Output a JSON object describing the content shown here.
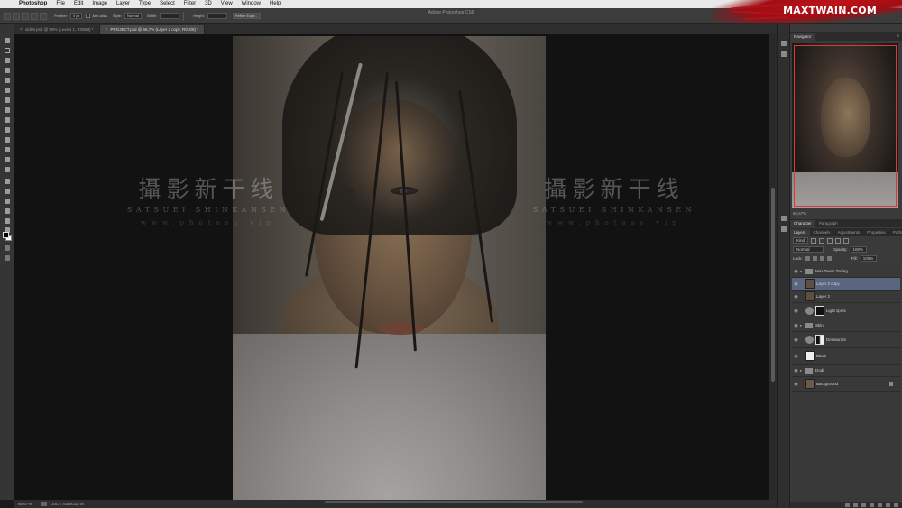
{
  "menubar": {
    "app_name": "Photoshop",
    "items": [
      "File",
      "Edit",
      "Image",
      "Layer",
      "Type",
      "Select",
      "Filter",
      "3D",
      "View",
      "Window",
      "Help"
    ]
  },
  "brand": {
    "name": "MAXTWAIN.COM",
    "color": "#b3121a"
  },
  "window": {
    "title": "Adobe Photoshop CS6"
  },
  "options": {
    "feather_label": "Feather:",
    "feather_value": "0 px",
    "antialias_label": "Anti-alias",
    "style_label": "Style:",
    "style_value": "Normal",
    "width_label": "Width:",
    "height_label": "Height:",
    "refine_label": "Refine Edge..."
  },
  "tabs": [
    {
      "label": "old05.psd @ 50% (Levels 1, RGB/8) *",
      "active": false
    },
    {
      "label": "PROJECT.psd @ 66,7% (Layer 2 copy, RGB/8) *",
      "active": true
    }
  ],
  "watermark": {
    "cn": "攝影新干线",
    "en": "SATSUEI SHINKANSEN",
    "url": "www.photoss.vip"
  },
  "status": {
    "zoom": "66,67%",
    "doc": "Doc: 7,63M/33,7M"
  },
  "navigator": {
    "tab": "Navigator",
    "zoom": "66,67%"
  },
  "layers_panel": {
    "top_tabs": [
      "Character",
      "Paragraph"
    ],
    "tabs": [
      "Layers",
      "Channels",
      "Adjustments",
      "Properties",
      "Paths"
    ],
    "kind_filter": "Kind",
    "blend_mode": "Normal",
    "opacity_label": "Opacity:",
    "opacity_value": "100%",
    "lock_label": "Lock:",
    "fill_label": "Fill:",
    "fill_value": "100%"
  },
  "layers": [
    {
      "name": "Max Twain Toning",
      "type": "group",
      "selected": false
    },
    {
      "name": "Layer 2 copy",
      "type": "pixel",
      "selected": true
    },
    {
      "name": "Layer 2",
      "type": "pixel",
      "selected": false
    },
    {
      "name": "Light spots",
      "type": "adjustment",
      "selected": false
    },
    {
      "name": "Skin",
      "type": "group",
      "selected": false
    },
    {
      "name": "Desaturate",
      "type": "adjustment",
      "selected": false
    },
    {
      "name": "Black",
      "type": "fill",
      "selected": false
    },
    {
      "name": "Dodi",
      "type": "group",
      "selected": false
    },
    {
      "name": "Background",
      "type": "background",
      "selected": false
    }
  ],
  "icons": {
    "apple": "apple-icon",
    "eye": "eye-icon",
    "folder": "folder-icon",
    "lock": "lock-icon",
    "panel_menu": "panel-menu-icon"
  }
}
